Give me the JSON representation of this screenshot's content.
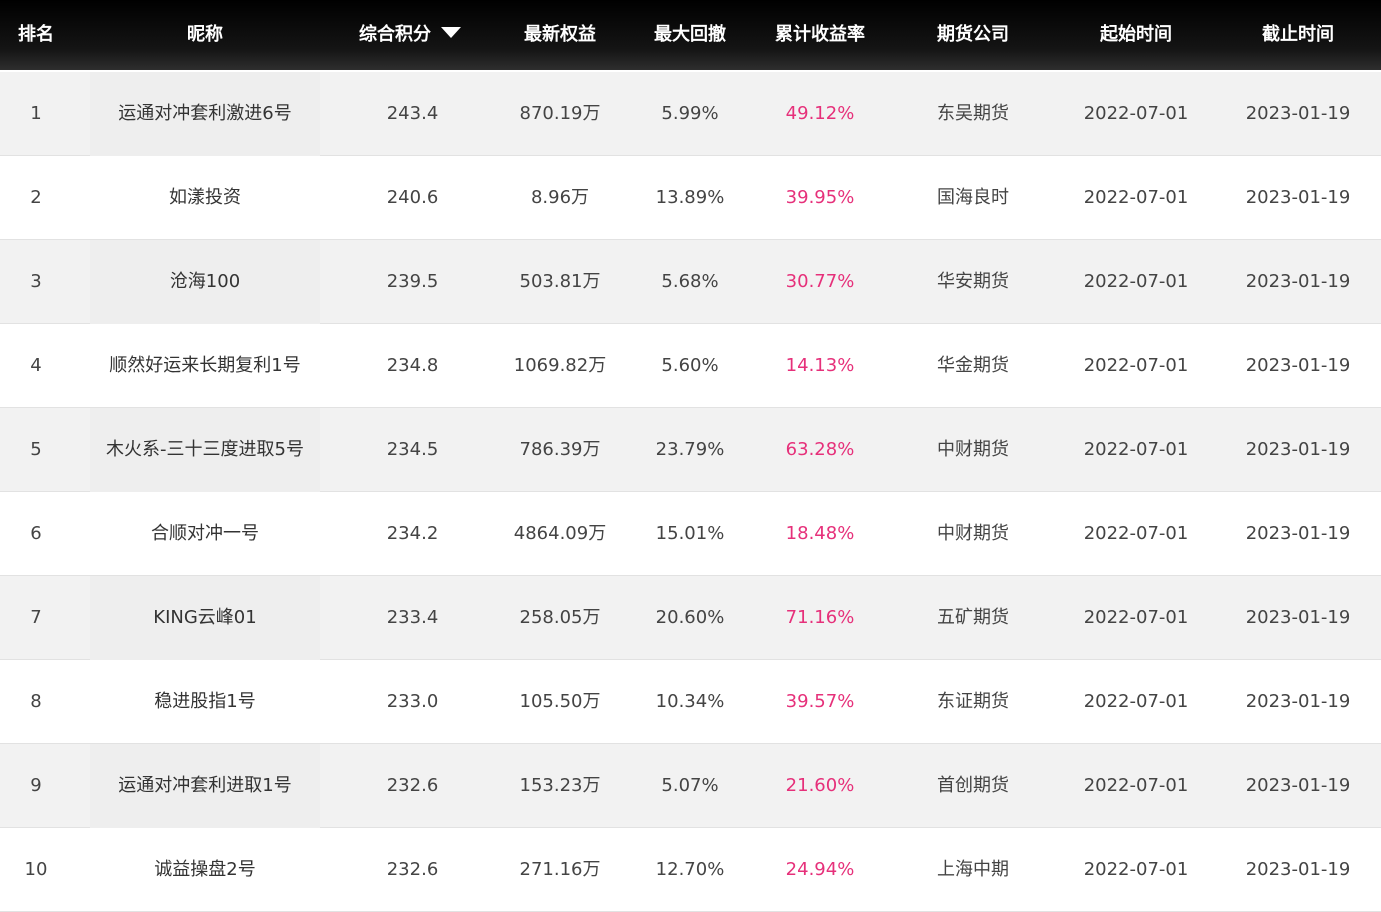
{
  "headers": {
    "rank": "排名",
    "name": "昵称",
    "score": "综合积分",
    "equity": "最新权益",
    "drawdown": "最大回撤",
    "return": "累计收益率",
    "broker": "期货公司",
    "start": "起始时间",
    "end": "截止时间"
  },
  "sort_icon": "caret-down-icon",
  "colors": {
    "header_bg": "#000000",
    "return": "#e6307a",
    "row_alt": "#f2f2f2"
  },
  "rows": [
    {
      "rank": "1",
      "name": "运通对冲套利激进6号",
      "score": "243.4",
      "equity": "870.19万",
      "drawdown": "5.99%",
      "return": "49.12%",
      "broker": "东吴期货",
      "start": "2022-07-01",
      "end": "2023-01-19"
    },
    {
      "rank": "2",
      "name": "如漾投资",
      "score": "240.6",
      "equity": "8.96万",
      "drawdown": "13.89%",
      "return": "39.95%",
      "broker": "国海良时",
      "start": "2022-07-01",
      "end": "2023-01-19"
    },
    {
      "rank": "3",
      "name": "沧海100",
      "score": "239.5",
      "equity": "503.81万",
      "drawdown": "5.68%",
      "return": "30.77%",
      "broker": "华安期货",
      "start": "2022-07-01",
      "end": "2023-01-19"
    },
    {
      "rank": "4",
      "name": "顺然好运来长期复利1号",
      "score": "234.8",
      "equity": "1069.82万",
      "drawdown": "5.60%",
      "return": "14.13%",
      "broker": "华金期货",
      "start": "2022-07-01",
      "end": "2023-01-19"
    },
    {
      "rank": "5",
      "name": "木火系-三十三度进取5号",
      "score": "234.5",
      "equity": "786.39万",
      "drawdown": "23.79%",
      "return": "63.28%",
      "broker": "中财期货",
      "start": "2022-07-01",
      "end": "2023-01-19"
    },
    {
      "rank": "6",
      "name": "合顺对冲一号",
      "score": "234.2",
      "equity": "4864.09万",
      "drawdown": "15.01%",
      "return": "18.48%",
      "broker": "中财期货",
      "start": "2022-07-01",
      "end": "2023-01-19"
    },
    {
      "rank": "7",
      "name": "KING云峰01",
      "score": "233.4",
      "equity": "258.05万",
      "drawdown": "20.60%",
      "return": "71.16%",
      "broker": "五矿期货",
      "start": "2022-07-01",
      "end": "2023-01-19"
    },
    {
      "rank": "8",
      "name": "稳进股指1号",
      "score": "233.0",
      "equity": "105.50万",
      "drawdown": "10.34%",
      "return": "39.57%",
      "broker": "东证期货",
      "start": "2022-07-01",
      "end": "2023-01-19"
    },
    {
      "rank": "9",
      "name": "运通对冲套利进取1号",
      "score": "232.6",
      "equity": "153.23万",
      "drawdown": "5.07%",
      "return": "21.60%",
      "broker": "首创期货",
      "start": "2022-07-01",
      "end": "2023-01-19"
    },
    {
      "rank": "10",
      "name": "诚益操盘2号",
      "score": "232.6",
      "equity": "271.16万",
      "drawdown": "12.70%",
      "return": "24.94%",
      "broker": "上海中期",
      "start": "2022-07-01",
      "end": "2023-01-19"
    }
  ]
}
